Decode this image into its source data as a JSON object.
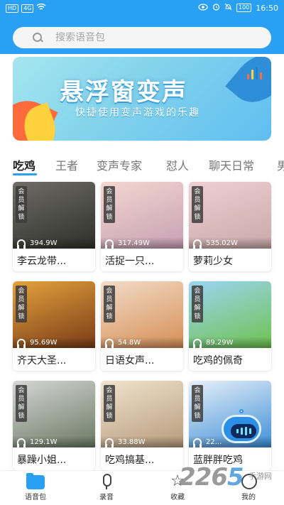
{
  "status_bar": {
    "left_badges": [
      "HD",
      "4G"
    ],
    "time": "16:50",
    "battery": "100"
  },
  "search": {
    "placeholder": "搜索语音包"
  },
  "banner": {
    "title": "悬浮窗变声",
    "subtitle": "快捷使用变声游戏的乐趣"
  },
  "tabs": [
    {
      "label": "吃鸡",
      "active": true
    },
    {
      "label": "王者",
      "active": false
    },
    {
      "label": "变声专家",
      "active": false
    },
    {
      "label": "怼人",
      "active": false
    },
    {
      "label": "聊天日常",
      "active": false
    },
    {
      "label": "男",
      "active": false
    }
  ],
  "cards": [
    {
      "badge": "会员解锁",
      "plays": "394.9W",
      "name": "李云龙带...",
      "colors": [
        "#6e6e66",
        "#2f2f2b"
      ]
    },
    {
      "badge": "会员解锁",
      "plays": "317.49W",
      "name": "活捉一只...",
      "colors": [
        "#f4d6cf",
        "#c7a0b4"
      ]
    },
    {
      "badge": "会员解锁",
      "plays": "535.02W",
      "name": "萝莉少女",
      "colors": [
        "#f0cfd2",
        "#c9a8a9"
      ]
    },
    {
      "badge": "会员解锁",
      "plays": "95.69W",
      "name": "齐天大圣...",
      "colors": [
        "#e3a23c",
        "#7a3b18"
      ]
    },
    {
      "badge": "会员解锁",
      "plays": "54.8W",
      "name": "日语女声...",
      "colors": [
        "#f2dcc8",
        "#d58f56"
      ]
    },
    {
      "badge": "会员解锁",
      "plays": "89.29W",
      "name": "吃鸡的佩奇",
      "colors": [
        "#9cd4f2",
        "#6ec24f"
      ]
    },
    {
      "badge": "会员解锁",
      "plays": "129.1W",
      "name": "暴躁小姐...",
      "colors": [
        "#d5d5d5",
        "#6a7a62"
      ]
    },
    {
      "badge": "会员解锁",
      "plays": "33.88W",
      "name": "吃鸡搞基...",
      "colors": [
        "#f0e3cf",
        "#b79b7a"
      ]
    },
    {
      "badge": "会员解锁",
      "plays": "22...",
      "name": "蓝胖胖吃鸡",
      "colors": [
        "#e8f0f8",
        "#3f8fd8"
      ]
    }
  ],
  "tabbar": [
    {
      "label": "语音包",
      "icon": "folder-icon",
      "active": true
    },
    {
      "label": "录音",
      "icon": "mic-icon",
      "active": false
    },
    {
      "label": "收藏",
      "icon": "star-icon",
      "active": false
    },
    {
      "label": "我的",
      "icon": "user-icon",
      "active": false
    }
  ],
  "watermark": {
    "text_a": "226",
    "text_b": "5",
    "sub": "手游网"
  },
  "colors": {
    "accent": "#2aa0f5"
  }
}
